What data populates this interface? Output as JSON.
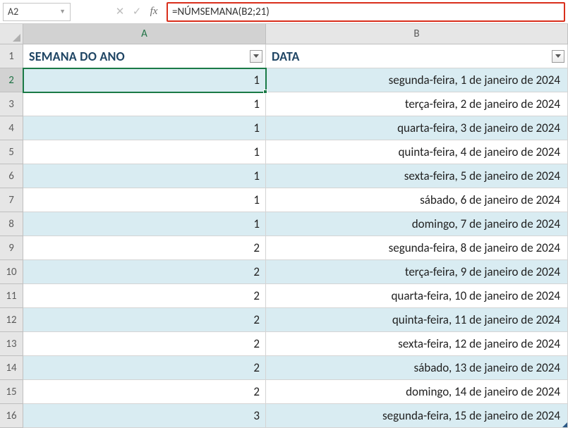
{
  "formula_bar": {
    "cell_ref": "A2",
    "cancel_glyph": "✕",
    "confirm_glyph": "✓",
    "fx_label": "fx",
    "formula": "=NÚMSEMANA(B2;21)"
  },
  "columns": [
    "A",
    "B"
  ],
  "active_column": "A",
  "active_row": 2,
  "headers": {
    "colA": "SEMANA DO ANO",
    "colB": "DATA"
  },
  "rows": [
    {
      "n": 1,
      "week": "",
      "date": ""
    },
    {
      "n": 2,
      "week": "1",
      "date": "segunda-feira, 1 de janeiro de 2024"
    },
    {
      "n": 3,
      "week": "1",
      "date": "terça-feira, 2 de janeiro de 2024"
    },
    {
      "n": 4,
      "week": "1",
      "date": "quarta-feira, 3 de janeiro de 2024"
    },
    {
      "n": 5,
      "week": "1",
      "date": "quinta-feira, 4 de janeiro de 2024"
    },
    {
      "n": 6,
      "week": "1",
      "date": "sexta-feira, 5 de janeiro de 2024"
    },
    {
      "n": 7,
      "week": "1",
      "date": "sábado, 6 de janeiro de 2024"
    },
    {
      "n": 8,
      "week": "1",
      "date": "domingo, 7 de janeiro de 2024"
    },
    {
      "n": 9,
      "week": "2",
      "date": "segunda-feira, 8 de janeiro de 2024"
    },
    {
      "n": 10,
      "week": "2",
      "date": "terça-feira, 9 de janeiro de 2024"
    },
    {
      "n": 11,
      "week": "2",
      "date": "quarta-feira, 10 de janeiro de 2024"
    },
    {
      "n": 12,
      "week": "2",
      "date": "quinta-feira, 11 de janeiro de 2024"
    },
    {
      "n": 13,
      "week": "2",
      "date": "sexta-feira, 12 de janeiro de 2024"
    },
    {
      "n": 14,
      "week": "2",
      "date": "sábado, 13 de janeiro de 2024"
    },
    {
      "n": 15,
      "week": "2",
      "date": "domingo, 14 de janeiro de 2024"
    },
    {
      "n": 16,
      "week": "3",
      "date": "segunda-feira, 15 de janeiro de 2024"
    }
  ]
}
